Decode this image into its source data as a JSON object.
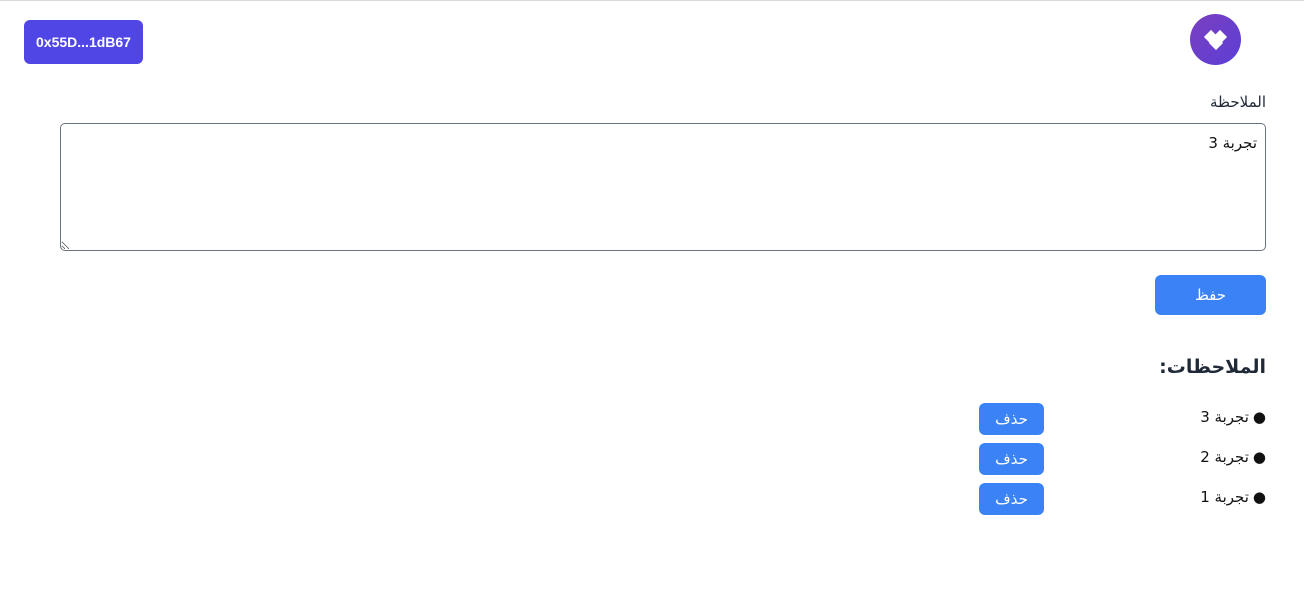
{
  "header": {
    "wallet_address": "0x55D...1dB67",
    "logo_icon": "wallet-logo-icon",
    "logo_gradient": [
      "#7b3fbf",
      "#5b3fd6"
    ]
  },
  "form": {
    "label": "الملاحظة",
    "input_value": "تجربة 3",
    "save_label": "حفظ"
  },
  "notes": {
    "heading": "الملاحظات:",
    "items": [
      {
        "text": "تجربة 3",
        "delete_label": "حذف"
      },
      {
        "text": "تجربة 2",
        "delete_label": "حذف"
      },
      {
        "text": "تجربة 1",
        "delete_label": "حذف"
      }
    ]
  },
  "colors": {
    "wallet_button": "#4f46e5",
    "primary_button": "#3b82f6"
  }
}
